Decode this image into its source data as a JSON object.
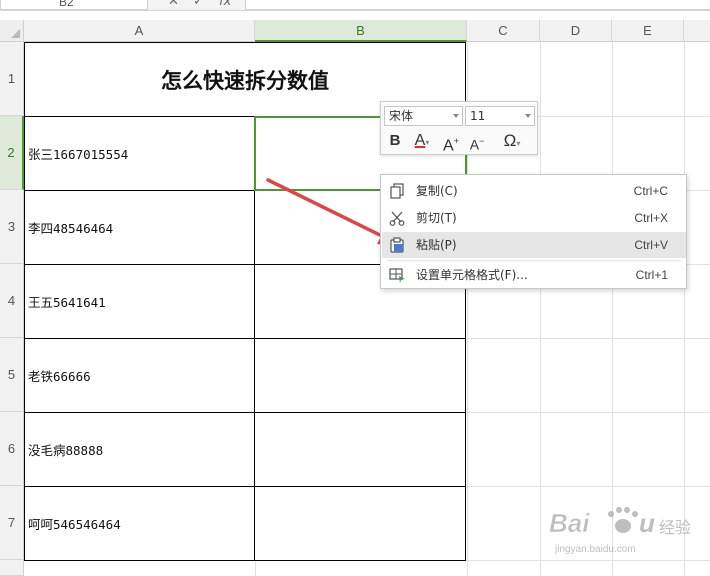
{
  "namebox": {
    "value": "B2"
  },
  "formula_bar": {
    "cancel_glyph": "✕",
    "confirm_glyph": "✓",
    "fx_label": "fx"
  },
  "columns": [
    "A",
    "B",
    "C",
    "D",
    "E"
  ],
  "rows": [
    "1",
    "2",
    "3",
    "4",
    "5",
    "6",
    "7"
  ],
  "active_cell": "B2",
  "table": {
    "title": "怎么快速拆分数值",
    "entries": [
      "张三1667015554",
      "李四48546464",
      "王五5641641",
      "老铁66666",
      "没毛病88888",
      "呵呵546546464"
    ]
  },
  "mini_toolbar": {
    "font_name": "宋体",
    "font_size": "11",
    "bold_label": "B",
    "font_color_label": "A",
    "font_color_hex": "#e03030",
    "grow_label": "A",
    "shrink_label": "A",
    "symbol_label": "Ω"
  },
  "context_menu": {
    "items": [
      {
        "label": "复制(C)",
        "shortcut": "Ctrl+C",
        "icon": "copy-icon"
      },
      {
        "label": "剪切(T)",
        "shortcut": "Ctrl+X",
        "icon": "scissors-icon"
      },
      {
        "label": "粘贴(P)",
        "shortcut": "Ctrl+V",
        "icon": "paste-icon",
        "highlighted": true
      },
      {
        "label": "设置单元格格式(F)...",
        "shortcut": "Ctrl+1",
        "icon": "format-cells-icon"
      }
    ]
  },
  "annotation": {
    "type": "arrow",
    "color": "#e04545",
    "points_to": "粘贴(P)"
  },
  "colors": {
    "selection_green": "#4a9a2e",
    "header_bg": "#f2f2f2",
    "menu_hover": "#e6e6e6"
  },
  "watermark": {
    "brand": "Baidu",
    "brand_cn": "经验",
    "url": "jingyan.baidu.com"
  }
}
